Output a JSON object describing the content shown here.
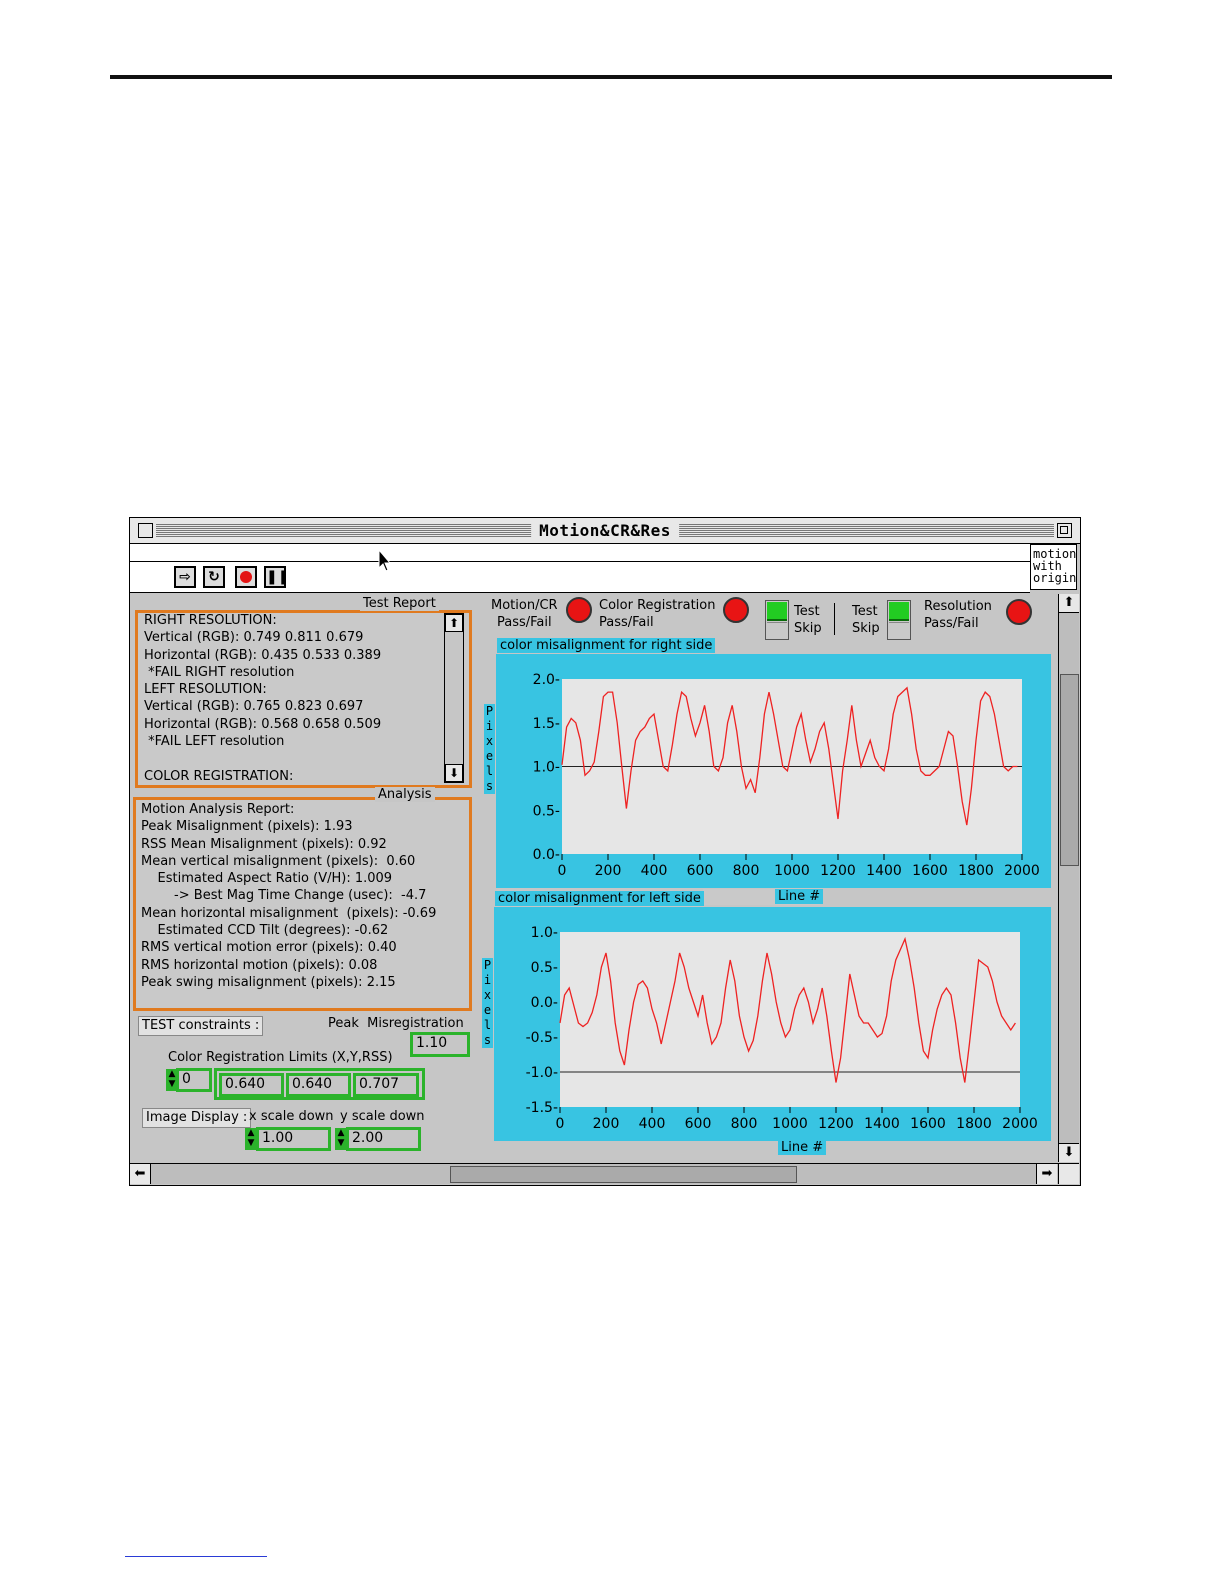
{
  "window": {
    "title": "Motion&CR&Res",
    "context_box": [
      "motion",
      "with",
      "origin"
    ]
  },
  "test_report": {
    "label": "Test Report",
    "lines": [
      "RIGHT RESOLUTION:",
      "Vertical (RGB): 0.749 0.811 0.679",
      "Horizontal (RGB): 0.435 0.533 0.389",
      " *FAIL RIGHT resolution",
      "LEFT RESOLUTION:",
      "Vertical (RGB): 0.765 0.823 0.697",
      "Horizontal (RGB): 0.568 0.658 0.509",
      " *FAIL LEFT resolution",
      "",
      "COLOR REGISTRATION:"
    ]
  },
  "analysis": {
    "label": "Analysis",
    "lines": [
      "Motion Analysis Report:",
      "Peak Misalignment (pixels): 1.93",
      "RSS Mean Misalignment (pixels): 0.92",
      "Mean vertical misalignment (pixels):  0.60",
      "    Estimated Aspect Ratio (V/H): 1.009",
      "        -> Best Mag Time Change (usec):  -4.7",
      "Mean horizontal misalignment  (pixels): -0.69",
      "    Estimated CCD Tilt (degrees): -0.62",
      "RMS vertical motion error (pixels): 0.40",
      "RMS horizontal motion (pixels): 0.08",
      "Peak swing misalignment (pixels): 2.15"
    ]
  },
  "constraints": {
    "test_constraints_button": "TEST constraints :",
    "peak_label": "Peak  Misregistration",
    "peak_value": "1.10",
    "cr_limits_label": "Color Registration Limits (X,Y,RSS)",
    "index_value": "0",
    "limits": [
      "0.640",
      "0.640",
      "0.707"
    ],
    "image_display_button": "Image Display :",
    "x_scale_label": "x scale down",
    "y_scale_label": "y scale down",
    "x_scale_value": "1.00",
    "y_scale_value": "2.00"
  },
  "indicators": {
    "motion_cr": [
      "Motion/CR",
      "Pass/Fail"
    ],
    "color_reg": [
      "Color Registration",
      "Pass/Fail"
    ],
    "toggle1": [
      "Test",
      "Skip"
    ],
    "toggle2": [
      "Test",
      "Skip"
    ],
    "resolution": [
      "Resolution",
      "Pass/Fail"
    ]
  },
  "colors": {
    "panel_border": "#e07a1f",
    "graph_bg": "#38c4e2",
    "trace": "#ee2222",
    "led": "#e81414",
    "field_border": "#2bb32b"
  },
  "chart_data": [
    {
      "type": "line",
      "title": "color misalignment for right side",
      "xlabel": "Line #",
      "ylabel": "Pixels",
      "xlim": [
        0,
        2000
      ],
      "ylim": [
        0,
        2.0
      ],
      "xticks": [
        "0",
        "200",
        "400",
        "600",
        "800",
        "1000",
        "1200",
        "1400",
        "1600",
        "1800",
        "2000"
      ],
      "yticks": [
        "2.0-",
        "1.5-",
        "1.0-",
        "0.5-",
        "0.0-"
      ],
      "reference_line": 1.0,
      "series": [
        {
          "x": [
            0,
            20,
            40,
            60,
            80,
            100,
            120,
            140,
            160,
            180,
            200,
            220,
            240,
            260,
            280,
            300,
            320,
            340,
            360,
            380,
            400,
            420,
            440,
            460,
            480,
            500,
            520,
            540,
            560,
            580,
            600,
            620,
            640,
            660,
            680,
            700,
            720,
            740,
            760,
            780,
            800,
            820,
            840,
            860,
            880,
            900,
            920,
            940,
            960,
            980,
            1000,
            1020,
            1040,
            1060,
            1080,
            1100,
            1120,
            1140,
            1160,
            1180,
            1200,
            1220,
            1240,
            1260,
            1280,
            1300,
            1320,
            1340,
            1360,
            1380,
            1400,
            1420,
            1440,
            1460,
            1480,
            1500,
            1520,
            1540,
            1560,
            1580,
            1600,
            1620,
            1640,
            1660,
            1680,
            1700,
            1720,
            1740,
            1760,
            1780,
            1800,
            1820,
            1840,
            1860,
            1880,
            1900,
            1920,
            1940,
            1960,
            1980
          ],
          "values": [
            1.02,
            1.45,
            1.55,
            1.5,
            1.3,
            0.9,
            0.95,
            1.05,
            1.4,
            1.8,
            1.85,
            1.85,
            1.5,
            1.0,
            0.52,
            0.95,
            1.3,
            1.4,
            1.45,
            1.55,
            1.6,
            1.3,
            1.0,
            0.95,
            1.25,
            1.6,
            1.85,
            1.8,
            1.55,
            1.35,
            1.5,
            1.7,
            1.4,
            1.0,
            0.95,
            1.1,
            1.5,
            1.7,
            1.4,
            1.0,
            0.75,
            0.85,
            0.7,
            1.1,
            1.6,
            1.85,
            1.6,
            1.3,
            1.0,
            0.95,
            1.2,
            1.45,
            1.6,
            1.3,
            1.05,
            1.2,
            1.4,
            1.5,
            1.2,
            0.8,
            0.4,
            0.95,
            1.3,
            1.7,
            1.3,
            1.0,
            1.15,
            1.3,
            1.1,
            1.0,
            0.95,
            1.2,
            1.6,
            1.8,
            1.85,
            1.9,
            1.6,
            1.2,
            0.95,
            0.9,
            0.9,
            0.95,
            1.0,
            1.2,
            1.4,
            1.35,
            1.0,
            0.6,
            0.33,
            0.75,
            1.3,
            1.75,
            1.85,
            1.8,
            1.6,
            1.3,
            1.0,
            0.95,
            1.0,
            1.0
          ],
          "color": "#ee2222"
        }
      ]
    },
    {
      "type": "line",
      "title": "color misalignment for left side",
      "xlabel": "Line #",
      "ylabel": "Pixels",
      "xlim": [
        0,
        2000
      ],
      "ylim": [
        -1.5,
        1.0
      ],
      "xticks": [
        "0",
        "200",
        "400",
        "600",
        "800",
        "1000",
        "1200",
        "1400",
        "1600",
        "1800",
        "2000"
      ],
      "yticks": [
        "1.0-",
        "0.5-",
        "0.0-",
        "-0.5-",
        "-1.0-",
        "-1.5-"
      ],
      "reference_line": -1.0,
      "series": [
        {
          "x": [
            0,
            20,
            40,
            60,
            80,
            100,
            120,
            140,
            160,
            180,
            200,
            220,
            240,
            260,
            280,
            300,
            320,
            340,
            360,
            380,
            400,
            420,
            440,
            460,
            480,
            500,
            520,
            540,
            560,
            580,
            600,
            620,
            640,
            660,
            680,
            700,
            720,
            740,
            760,
            780,
            800,
            820,
            840,
            860,
            880,
            900,
            920,
            940,
            960,
            980,
            1000,
            1020,
            1040,
            1060,
            1080,
            1100,
            1120,
            1140,
            1160,
            1180,
            1200,
            1220,
            1240,
            1260,
            1280,
            1300,
            1320,
            1340,
            1360,
            1380,
            1400,
            1420,
            1440,
            1460,
            1480,
            1500,
            1520,
            1540,
            1560,
            1580,
            1600,
            1620,
            1640,
            1660,
            1680,
            1700,
            1720,
            1740,
            1760,
            1780,
            1800,
            1820,
            1840,
            1860,
            1880,
            1900,
            1920,
            1940,
            1960,
            1980
          ],
          "values": [
            -0.3,
            0.1,
            0.2,
            -0.05,
            -0.3,
            -0.35,
            -0.3,
            -0.15,
            0.1,
            0.5,
            0.7,
            0.3,
            -0.3,
            -0.7,
            -0.9,
            -0.4,
            0.0,
            0.25,
            0.3,
            0.2,
            -0.1,
            -0.3,
            -0.6,
            -0.3,
            0.0,
            0.3,
            0.7,
            0.5,
            0.2,
            0.0,
            -0.2,
            0.1,
            -0.3,
            -0.6,
            -0.5,
            -0.3,
            0.2,
            0.6,
            0.3,
            -0.2,
            -0.5,
            -0.7,
            -0.55,
            -0.2,
            0.3,
            0.7,
            0.4,
            0.0,
            -0.3,
            -0.5,
            -0.4,
            -0.1,
            0.1,
            0.2,
            0.0,
            -0.3,
            -0.1,
            0.2,
            -0.2,
            -0.7,
            -1.15,
            -0.8,
            -0.2,
            0.4,
            0.1,
            -0.2,
            -0.3,
            -0.3,
            -0.4,
            -0.5,
            -0.45,
            -0.2,
            0.3,
            0.6,
            0.75,
            0.9,
            0.6,
            0.2,
            -0.3,
            -0.7,
            -0.8,
            -0.4,
            -0.1,
            0.1,
            0.2,
            0.1,
            -0.3,
            -0.8,
            -1.15,
            -0.6,
            0.0,
            0.6,
            0.55,
            0.5,
            0.3,
            0.0,
            -0.2,
            -0.3,
            -0.4,
            -0.3
          ],
          "color": "#ee2222"
        }
      ]
    }
  ]
}
